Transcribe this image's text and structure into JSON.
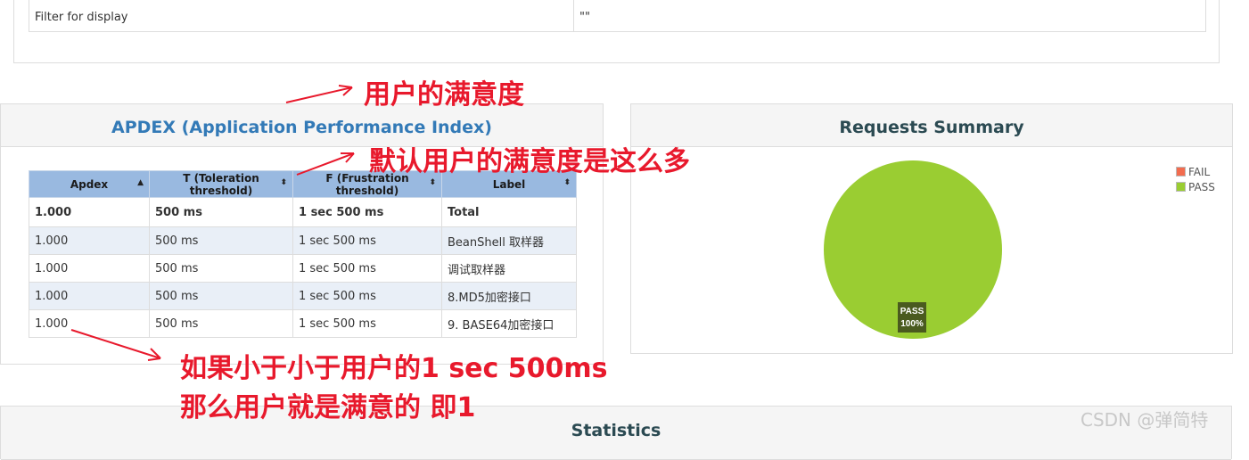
{
  "filter": {
    "label": "Filter for display",
    "value": "\"\""
  },
  "apdex": {
    "title": "APDEX (Application Performance Index)",
    "columns": [
      "Apdex",
      "T (Toleration threshold)",
      "F (Frustration threshold)",
      "Label"
    ],
    "rows": [
      {
        "apdex": "1.000",
        "t": "500 ms",
        "f": "1 sec 500 ms",
        "label": "Total"
      },
      {
        "apdex": "1.000",
        "t": "500 ms",
        "f": "1 sec 500 ms",
        "label": "BeanShell 取样器"
      },
      {
        "apdex": "1.000",
        "t": "500 ms",
        "f": "1 sec 500 ms",
        "label": "调试取样器"
      },
      {
        "apdex": "1.000",
        "t": "500 ms",
        "f": "1 sec 500 ms",
        "label": "8.MD5加密接口"
      },
      {
        "apdex": "1.000",
        "t": "500 ms",
        "f": "1 sec 500 ms",
        "label": "9. BASE64加密接口"
      }
    ]
  },
  "summary": {
    "title": "Requests Summary",
    "legend": [
      {
        "name": "FAIL",
        "color": "#f26c4f"
      },
      {
        "name": "PASS",
        "color": "#9acd32"
      }
    ],
    "pie_label": "PASS",
    "pie_percent": "100%"
  },
  "statistics": {
    "title": "Statistics"
  },
  "annotations": {
    "a1": "用户的满意度",
    "a2": "默认用户的满意度是这么多",
    "a3": "如果小于小于用户的1 sec 500ms",
    "a4": "那么用户就是满意的 即1"
  },
  "watermark": "CSDN @弹简特",
  "colors": {
    "accent_red": "#e8192c",
    "header_blue": "#99b9e0",
    "title_blue": "#337ab7",
    "pass_green": "#9acd32",
    "fail_red": "#f26c4f"
  },
  "chart_data": {
    "type": "pie",
    "categories": [
      "FAIL",
      "PASS"
    ],
    "values": [
      0,
      100
    ],
    "title": "Requests Summary"
  }
}
